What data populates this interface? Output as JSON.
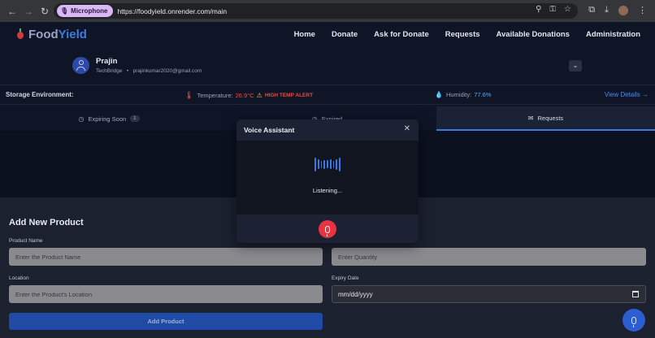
{
  "browser": {
    "mic_chip_label": "Microphone",
    "url": "https://foodyield.onrender.com/main"
  },
  "brand": {
    "name_a": "Food",
    "name_b": "Yield"
  },
  "nav": [
    {
      "label": "Home"
    },
    {
      "label": "Donate"
    },
    {
      "label": "Ask for Donate"
    },
    {
      "label": "Requests"
    },
    {
      "label": "Available Donations"
    },
    {
      "label": "Administration"
    }
  ],
  "profile": {
    "name": "Prajin",
    "org": "TechBridge",
    "email": "prajinkumar2020@gmail.com"
  },
  "storage": {
    "label": "Storage Environment:",
    "temperature_label": "Temperature:",
    "temperature_value": "26.9°C",
    "temp_alert": "HIGH TEMP ALERT",
    "humidity_label": "Humidity:",
    "humidity_value": "77.6%",
    "view_details": "View Details →"
  },
  "tabs": [
    {
      "label": "Expiring Soon",
      "count": "1"
    },
    {
      "label": "Expired"
    },
    {
      "label": "Requests"
    }
  ],
  "form": {
    "title": "Add New Product",
    "product_name_label": "Product Name",
    "product_name_placeholder": "Enter the Product Name",
    "quantity_placeholder": "Enter Quantity",
    "location_label": "Location",
    "location_placeholder": "Enter the Product's Location",
    "expiry_label": "Expiry Date",
    "expiry_value": "mm/dd/yyyy",
    "submit_label": "Add Product"
  },
  "voice_modal": {
    "title": "Voice Assistant",
    "status": "Listening..."
  },
  "colors": {
    "accent": "#3e7be0",
    "alert": "#f04a3a",
    "mic_active": "#ea3340"
  }
}
